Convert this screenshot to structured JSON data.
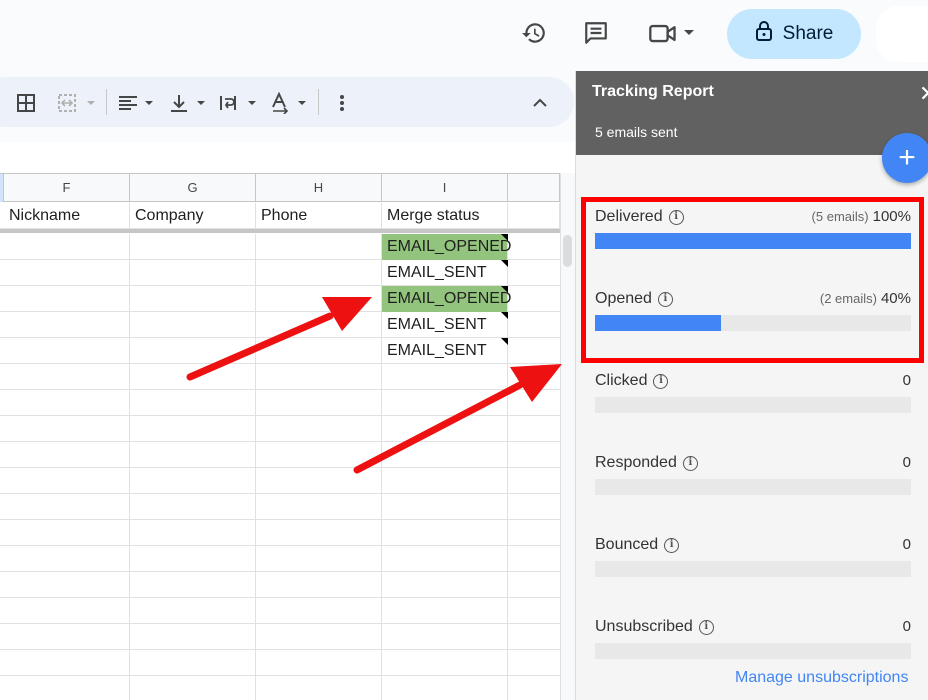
{
  "header": {
    "icons": [
      "version-history-icon",
      "comments-icon",
      "meet-video-icon",
      "chevron-down-icon",
      "lock-icon"
    ],
    "share_label": "Share"
  },
  "toolbar": {
    "icons": [
      "borders-icon",
      "merge-cells-icon",
      "horizontal-align-icon",
      "vertical-align-icon",
      "text-wrap-icon",
      "text-rotation-icon",
      "more-vert-icon",
      "collapse-icon"
    ]
  },
  "sheet": {
    "columns": [
      "F",
      "G",
      "H",
      "I"
    ],
    "headers": [
      "Nickname",
      "Company",
      "Phone",
      "Merge status"
    ],
    "merge_status": [
      "EMAIL_OPENED",
      "EMAIL_SENT",
      "EMAIL_OPENED",
      "EMAIL_SENT",
      "EMAIL_SENT"
    ],
    "opened_color": "#93c47d"
  },
  "panel": {
    "title": "Tracking Report",
    "subtitle": "5 emails sent",
    "close_icon": "close-icon",
    "fab_icon": "plus-icon",
    "metrics": [
      {
        "label": "Delivered",
        "count": "(5 emails)",
        "value": "100%",
        "fraction": 1.0
      },
      {
        "label": "Opened",
        "count": "(2 emails)",
        "value": "40%",
        "fraction": 0.4
      },
      {
        "label": "Clicked",
        "count": "",
        "value": "0",
        "fraction": 0
      },
      {
        "label": "Responded",
        "count": "",
        "value": "0",
        "fraction": 0
      },
      {
        "label": "Bounced",
        "count": "",
        "value": "0",
        "fraction": 0
      },
      {
        "label": "Unsubscribed",
        "count": "",
        "value": "0",
        "fraction": 0
      }
    ],
    "manage_link": "Manage unsubscriptions",
    "accent": "#4285f4",
    "header_bg": "#616161"
  },
  "annotations": {
    "highlight_color": "#ff0000"
  }
}
